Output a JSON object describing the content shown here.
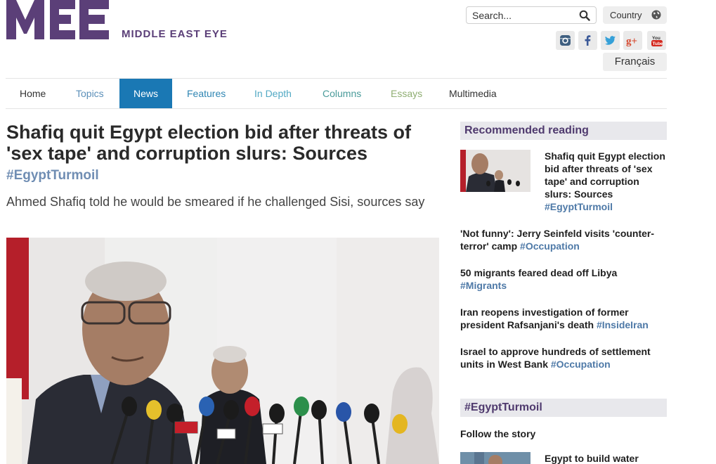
{
  "header": {
    "logo_text": "MEE",
    "brand": "MIDDLE EAST EYE",
    "search_placeholder": "Search...",
    "country_label": "Country",
    "social": [
      "instagram-icon",
      "facebook-icon",
      "twitter-icon",
      "google-plus-icon",
      "youtube-icon"
    ],
    "language_label": "Français"
  },
  "nav": {
    "items": [
      {
        "label": "Home",
        "color": "#333333"
      },
      {
        "label": "Topics",
        "color": "#5b8fb9"
      },
      {
        "label": "News",
        "color": "#ffffff"
      },
      {
        "label": "Features",
        "color": "#2f86b3"
      },
      {
        "label": "In Depth",
        "color": "#52a9c4"
      },
      {
        "label": "Columns",
        "color": "#4a9b9a"
      },
      {
        "label": "Essays",
        "color": "#8fae72"
      },
      {
        "label": "Multimedia",
        "color": "#333333"
      }
    ],
    "active": "News"
  },
  "article": {
    "headline": "Shafiq quit Egypt election bid after threats of 'sex tape' and corruption slurs: Sources",
    "hashtag": "#EgyptTurmoil",
    "standfirst": "Ahmed Shafiq told he would be smeared if he challenged Sisi, sources say"
  },
  "sidebar": {
    "recommended_heading": "Recommended reading",
    "recommended": [
      {
        "title": "Shafiq quit Egypt election bid after threats of 'sex tape' and corruption slurs: Sources",
        "tag": "#EgyptTurmoil"
      },
      {
        "title": "'Not funny': Jerry Seinfeld visits 'counter-terror' camp",
        "tag": "#Occupation"
      },
      {
        "title": "50 migrants feared dead off Libya",
        "tag": "#Migrants"
      },
      {
        "title": "Iran reopens investigation of former president Rafsanjani's death",
        "tag": "#InsideIran"
      },
      {
        "title": "Israel to approve hundreds of settlement units in West Bank",
        "tag": "#Occupation"
      }
    ],
    "topic_heading": "#EgyptTurmoil",
    "follow_label": "Follow the story",
    "follow_first_title": "Egypt to build water"
  },
  "colors": {
    "brand_purple": "#5b3f78",
    "nav_active": "#1a78b4",
    "tag_blue": "#4e79a7"
  }
}
